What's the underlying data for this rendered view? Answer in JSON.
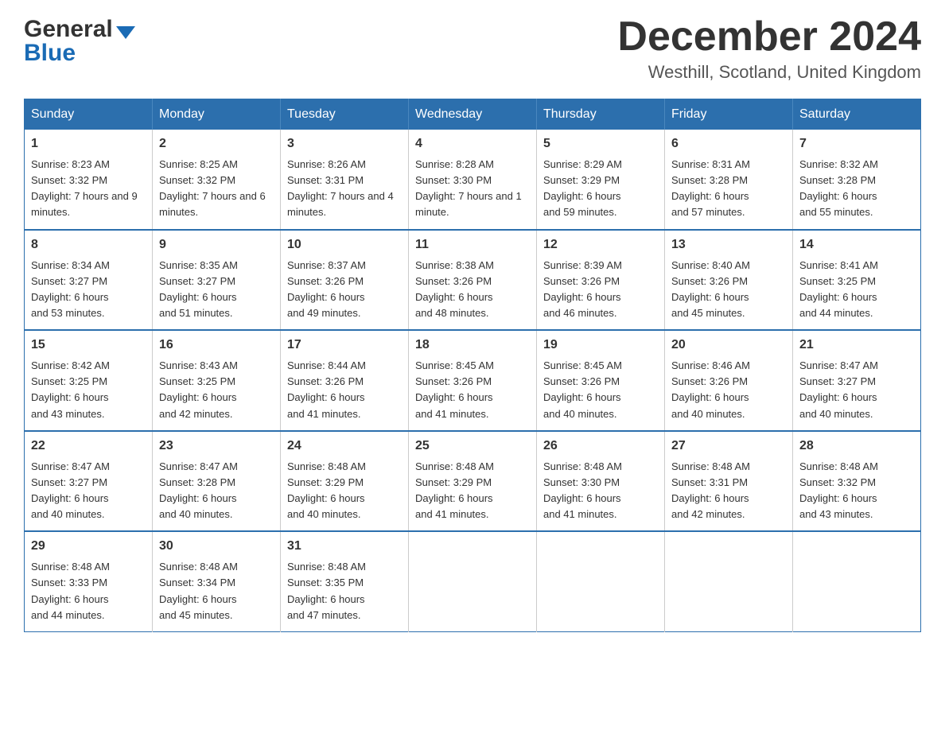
{
  "logo": {
    "line1": "General",
    "line2": "Blue"
  },
  "header": {
    "title": "December 2024",
    "location": "Westhill, Scotland, United Kingdom"
  },
  "days_of_week": [
    "Sunday",
    "Monday",
    "Tuesday",
    "Wednesday",
    "Thursday",
    "Friday",
    "Saturday"
  ],
  "weeks": [
    [
      {
        "day": "1",
        "sunrise": "8:23 AM",
        "sunset": "3:32 PM",
        "daylight": "7 hours and 9 minutes."
      },
      {
        "day": "2",
        "sunrise": "8:25 AM",
        "sunset": "3:32 PM",
        "daylight": "7 hours and 6 minutes."
      },
      {
        "day": "3",
        "sunrise": "8:26 AM",
        "sunset": "3:31 PM",
        "daylight": "7 hours and 4 minutes."
      },
      {
        "day": "4",
        "sunrise": "8:28 AM",
        "sunset": "3:30 PM",
        "daylight": "7 hours and 1 minute."
      },
      {
        "day": "5",
        "sunrise": "8:29 AM",
        "sunset": "3:29 PM",
        "daylight": "6 hours and 59 minutes."
      },
      {
        "day": "6",
        "sunrise": "8:31 AM",
        "sunset": "3:28 PM",
        "daylight": "6 hours and 57 minutes."
      },
      {
        "day": "7",
        "sunrise": "8:32 AM",
        "sunset": "3:28 PM",
        "daylight": "6 hours and 55 minutes."
      }
    ],
    [
      {
        "day": "8",
        "sunrise": "8:34 AM",
        "sunset": "3:27 PM",
        "daylight": "6 hours and 53 minutes."
      },
      {
        "day": "9",
        "sunrise": "8:35 AM",
        "sunset": "3:27 PM",
        "daylight": "6 hours and 51 minutes."
      },
      {
        "day": "10",
        "sunrise": "8:37 AM",
        "sunset": "3:26 PM",
        "daylight": "6 hours and 49 minutes."
      },
      {
        "day": "11",
        "sunrise": "8:38 AM",
        "sunset": "3:26 PM",
        "daylight": "6 hours and 48 minutes."
      },
      {
        "day": "12",
        "sunrise": "8:39 AM",
        "sunset": "3:26 PM",
        "daylight": "6 hours and 46 minutes."
      },
      {
        "day": "13",
        "sunrise": "8:40 AM",
        "sunset": "3:26 PM",
        "daylight": "6 hours and 45 minutes."
      },
      {
        "day": "14",
        "sunrise": "8:41 AM",
        "sunset": "3:25 PM",
        "daylight": "6 hours and 44 minutes."
      }
    ],
    [
      {
        "day": "15",
        "sunrise": "8:42 AM",
        "sunset": "3:25 PM",
        "daylight": "6 hours and 43 minutes."
      },
      {
        "day": "16",
        "sunrise": "8:43 AM",
        "sunset": "3:25 PM",
        "daylight": "6 hours and 42 minutes."
      },
      {
        "day": "17",
        "sunrise": "8:44 AM",
        "sunset": "3:26 PM",
        "daylight": "6 hours and 41 minutes."
      },
      {
        "day": "18",
        "sunrise": "8:45 AM",
        "sunset": "3:26 PM",
        "daylight": "6 hours and 41 minutes."
      },
      {
        "day": "19",
        "sunrise": "8:45 AM",
        "sunset": "3:26 PM",
        "daylight": "6 hours and 40 minutes."
      },
      {
        "day": "20",
        "sunrise": "8:46 AM",
        "sunset": "3:26 PM",
        "daylight": "6 hours and 40 minutes."
      },
      {
        "day": "21",
        "sunrise": "8:47 AM",
        "sunset": "3:27 PM",
        "daylight": "6 hours and 40 minutes."
      }
    ],
    [
      {
        "day": "22",
        "sunrise": "8:47 AM",
        "sunset": "3:27 PM",
        "daylight": "6 hours and 40 minutes."
      },
      {
        "day": "23",
        "sunrise": "8:47 AM",
        "sunset": "3:28 PM",
        "daylight": "6 hours and 40 minutes."
      },
      {
        "day": "24",
        "sunrise": "8:48 AM",
        "sunset": "3:29 PM",
        "daylight": "6 hours and 40 minutes."
      },
      {
        "day": "25",
        "sunrise": "8:48 AM",
        "sunset": "3:29 PM",
        "daylight": "6 hours and 41 minutes."
      },
      {
        "day": "26",
        "sunrise": "8:48 AM",
        "sunset": "3:30 PM",
        "daylight": "6 hours and 41 minutes."
      },
      {
        "day": "27",
        "sunrise": "8:48 AM",
        "sunset": "3:31 PM",
        "daylight": "6 hours and 42 minutes."
      },
      {
        "day": "28",
        "sunrise": "8:48 AM",
        "sunset": "3:32 PM",
        "daylight": "6 hours and 43 minutes."
      }
    ],
    [
      {
        "day": "29",
        "sunrise": "8:48 AM",
        "sunset": "3:33 PM",
        "daylight": "6 hours and 44 minutes."
      },
      {
        "day": "30",
        "sunrise": "8:48 AM",
        "sunset": "3:34 PM",
        "daylight": "6 hours and 45 minutes."
      },
      {
        "day": "31",
        "sunrise": "8:48 AM",
        "sunset": "3:35 PM",
        "daylight": "6 hours and 47 minutes."
      },
      null,
      null,
      null,
      null
    ]
  ],
  "labels": {
    "sunrise": "Sunrise:",
    "sunset": "Sunset:",
    "daylight": "Daylight:"
  }
}
